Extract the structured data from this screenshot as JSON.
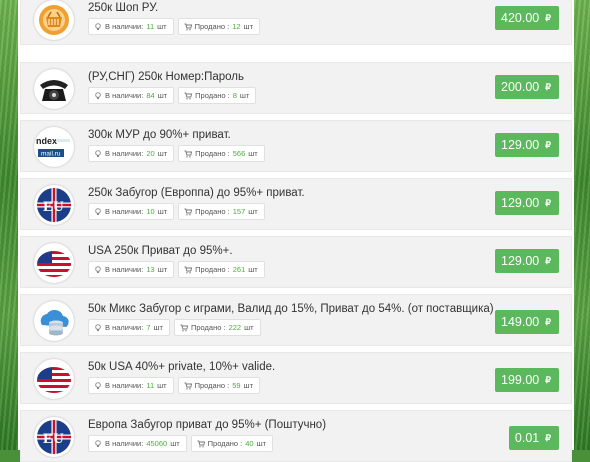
{
  "currency_symbol": "₽",
  "stock_label": "В наличии:",
  "sold_label": "Продано :",
  "unit": "шт",
  "items": [
    {
      "title": "250к Шоп РУ.",
      "stock": "11",
      "sold": "12",
      "price": "420.00",
      "icon": "basket-shop-icon"
    },
    {
      "title": "(РУ,СНГ) 250к Номер:Пароль",
      "stock": "84",
      "sold": "8",
      "price": "200.00",
      "icon": "rotary-phone-icon"
    },
    {
      "title": "300к МУР до 90%+ приват.",
      "stock": "20",
      "sold": "566",
      "price": "129.00",
      "icon": "yandex-mailru-logo-icon"
    },
    {
      "title": "250к Забугор (Европпа) до 95%+ приват.",
      "stock": "10",
      "sold": "157",
      "price": "129.00",
      "icon": "eu-flag-icon"
    },
    {
      "title": "USA 250к Приват до 95%+.",
      "stock": "13",
      "sold": "261",
      "price": "129.00",
      "icon": "usa-flag-icon"
    },
    {
      "title": "50к Микс Забугор с играми, Валид до 15%, Приват до 54%. (от поставщика)",
      "stock": "7",
      "sold": "222",
      "price": "149.00",
      "icon": "cloud-database-icon"
    },
    {
      "title": "50к USA 40%+ private, 10%+ valide.",
      "stock": "11",
      "sold": "59",
      "price": "199.00",
      "icon": "usa-flag-icon"
    },
    {
      "title": "Европа Забугор приват до 95%+ (Поштучно)",
      "stock": "45060",
      "sold": "40",
      "price": "0.01",
      "icon": "eu-flag-icon"
    }
  ],
  "logo_text": {
    "yandex": "ndex",
    "mailru": "mail.ru"
  }
}
